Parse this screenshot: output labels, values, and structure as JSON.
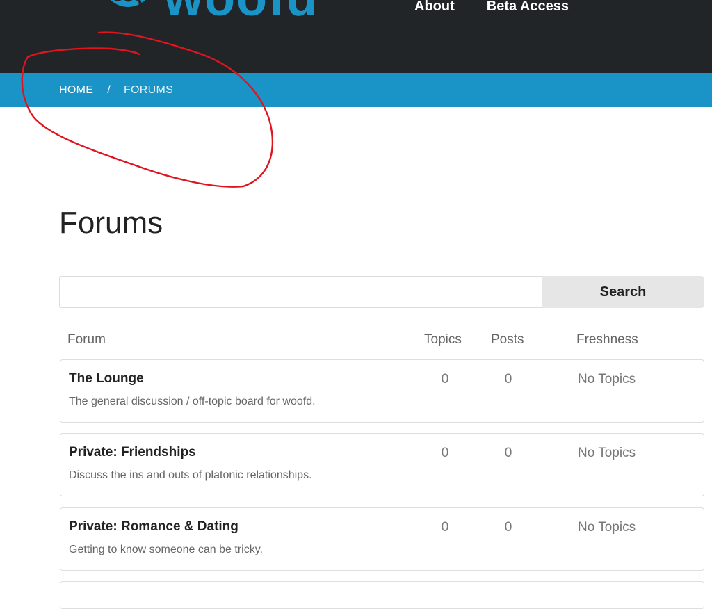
{
  "header": {
    "logo_text": "woofd",
    "nav": [
      {
        "label": "About"
      },
      {
        "label": "Beta Access"
      }
    ]
  },
  "breadcrumb": {
    "home": "HOME",
    "separator": "/",
    "current": "FORUMS"
  },
  "page": {
    "title": "Forums"
  },
  "search": {
    "value": "",
    "placeholder": "",
    "button_label": "Search"
  },
  "table": {
    "columns": {
      "forum": "Forum",
      "topics": "Topics",
      "posts": "Posts",
      "freshness": "Freshness"
    },
    "rows": [
      {
        "title": "The Lounge",
        "description": "The general discussion / off-topic board for woofd.",
        "topics": "0",
        "posts": "0",
        "freshness": "No Topics"
      },
      {
        "title": "Private: Friendships",
        "description": "Discuss the ins and outs of platonic relationships.",
        "topics": "0",
        "posts": "0",
        "freshness": "No Topics"
      },
      {
        "title": "Private: Romance & Dating",
        "description": "Getting to know someone can be tricky.",
        "topics": "0",
        "posts": "0",
        "freshness": "No Topics"
      }
    ]
  },
  "colors": {
    "header_bg": "#222528",
    "brand_blue": "#1a94c6",
    "annotation_red": "#e0141e",
    "search_button_bg": "#e6e6e6"
  }
}
